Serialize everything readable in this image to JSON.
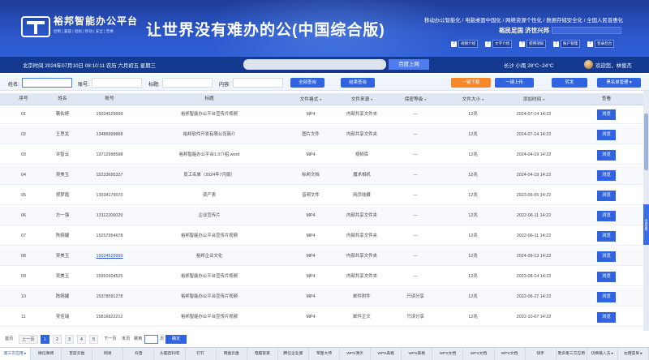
{
  "header": {
    "brand_name": "裕邦智能办公平台",
    "brand_sub": "控制 | 兼容 | 轻松 | 移动 | 安全 | 普惠",
    "slogan": "让世界没有难办的公(中国综合版)",
    "tagline": "移动办公智能化 / 电脑桌面中国化 / 网络资源个性化 / 数据存储安全化 / 全国人民普惠化",
    "place": "裕民足国 济世兴邦",
    "buttons": [
      {
        "icon": "?",
        "label": "视频介绍"
      },
      {
        "icon": "?",
        "label": "文字介绍"
      },
      {
        "icon": "?",
        "label": "使用須知"
      },
      {
        "icon": "?",
        "label": "账户管理"
      },
      {
        "icon": "?",
        "label": "登录后台"
      }
    ]
  },
  "infobar": {
    "datetime": "北京时间  2024年07月10日  08:10:11   农历 六月初五  星期三",
    "search_button": "百度上网",
    "weather": "长沙  小雨  28°C~24°C",
    "user": "欢迎您，林俊杰"
  },
  "filters": {
    "name_label": "姓名:",
    "account_label": "账号:",
    "title_label": "标题:",
    "content_label": "内容:",
    "query_all": "全部查询",
    "query_result": "结果查询",
    "download": "一键下载",
    "upload": "一键上传",
    "forward": "转发",
    "manage": "黑名单管理 ▾"
  },
  "table": {
    "headers": [
      "序号",
      "姓名",
      "账号",
      "标题",
      "文件格式",
      "文件来源",
      "保密等级",
      "文件大小",
      "添加时间",
      "查看"
    ],
    "dropdown_marker": "▾",
    "view_label": "浏览",
    "rows": [
      [
        "01",
        "蔡佑婷",
        "15034529999",
        "裕邦智能办公平台宣传片视频",
        "MP4",
        "内部共享文件夹",
        "---",
        "12兆",
        "2024-07-14 14:22"
      ],
      [
        "02",
        "王思龙",
        "13486999868",
        "裕邦软件开发有限公司简介",
        "图片文件",
        "内部共享文件夹",
        "---",
        "12兆",
        "2024-07-14 14:22"
      ],
      [
        "03",
        "许智云",
        "13712998598",
        "裕邦智能办公平台1.0介绍.word",
        "MP4",
        "视频库",
        "---",
        "12兆",
        "2024-04-19 14:22"
      ],
      [
        "04",
        "吴美玉",
        "15233695337",
        "员工名单（2024年7月版）",
        "标邦文档",
        "魔术相机",
        "---",
        "12兆",
        "2024-04-19 14:22"
      ],
      [
        "05",
        "郑梦霞",
        "13034179070",
        "资产表",
        "音频文件",
        "网页收藏",
        "---",
        "12兆",
        "2023-06-05 14:22"
      ],
      [
        "06",
        "方一强",
        "13112206029",
        "企业宣传片",
        "MP4",
        "内部共享文件夹",
        "---",
        "12兆",
        "2022-06-11 14:22"
      ],
      [
        "07",
        "陈婉婕",
        "15257954678",
        "裕邦智能办公平台宣传片视频",
        "MP4",
        "内部共享文件夹",
        "---",
        "12兆",
        "2022-06-11 14:22"
      ],
      [
        "08",
        "吴美玉",
        "15034529999",
        "裕邦企业文化",
        "MP4",
        "内部共享文件夹",
        "---",
        "12兆",
        "2024-09-13 14:22"
      ],
      [
        "09",
        "吴美玉",
        "15991604525",
        "裕邦智能办公平台宣传片视频",
        "MP4",
        "内部共享文件夹",
        "---",
        "12兆",
        "2023-08-14 14:22"
      ],
      [
        "10",
        "陈婉婕",
        "15378591278",
        "裕邦智能办公平台宣传片视频",
        "MP4",
        "邮件附件",
        "只读分享",
        "12兆",
        "2022-06-27 14:22"
      ],
      [
        "11",
        "吴佳瑞",
        "15816822212",
        "裕邦智能办公平台宣传片视频",
        "MP4",
        "邮件正文",
        "只读分享",
        "12兆",
        "2022-10-07 14:22"
      ]
    ]
  },
  "scroll_tab": "全部加载",
  "pager": {
    "first": "首页",
    "prev": "上一页",
    "pages": [
      "1",
      "2",
      "3",
      "4",
      "5"
    ],
    "next": "下一页",
    "last": "末页",
    "goto": "跳到",
    "page_unit": "页",
    "confirm": "确定"
  },
  "taskbar": [
    "第三方应用 ▸",
    "微信微博",
    "百度云盘",
    "网易",
    "抖音",
    "头脑百科吧",
    "钉钉",
    "网盘云盘",
    "电脑管家",
    "腾信企业版",
    "草图大师",
    "WPS演示",
    "WPS表格",
    "WPS表格",
    "WPS文档",
    "WPS文档",
    "WPS文档",
    "快手",
    "更多第三方应用",
    "切换输入法 ▸",
    "右键菜单 ▸"
  ],
  "colors": {
    "primary": "#2f63e0",
    "header": "#2a56c9",
    "infobar": "#133a8f",
    "accent": "#f6872a"
  }
}
